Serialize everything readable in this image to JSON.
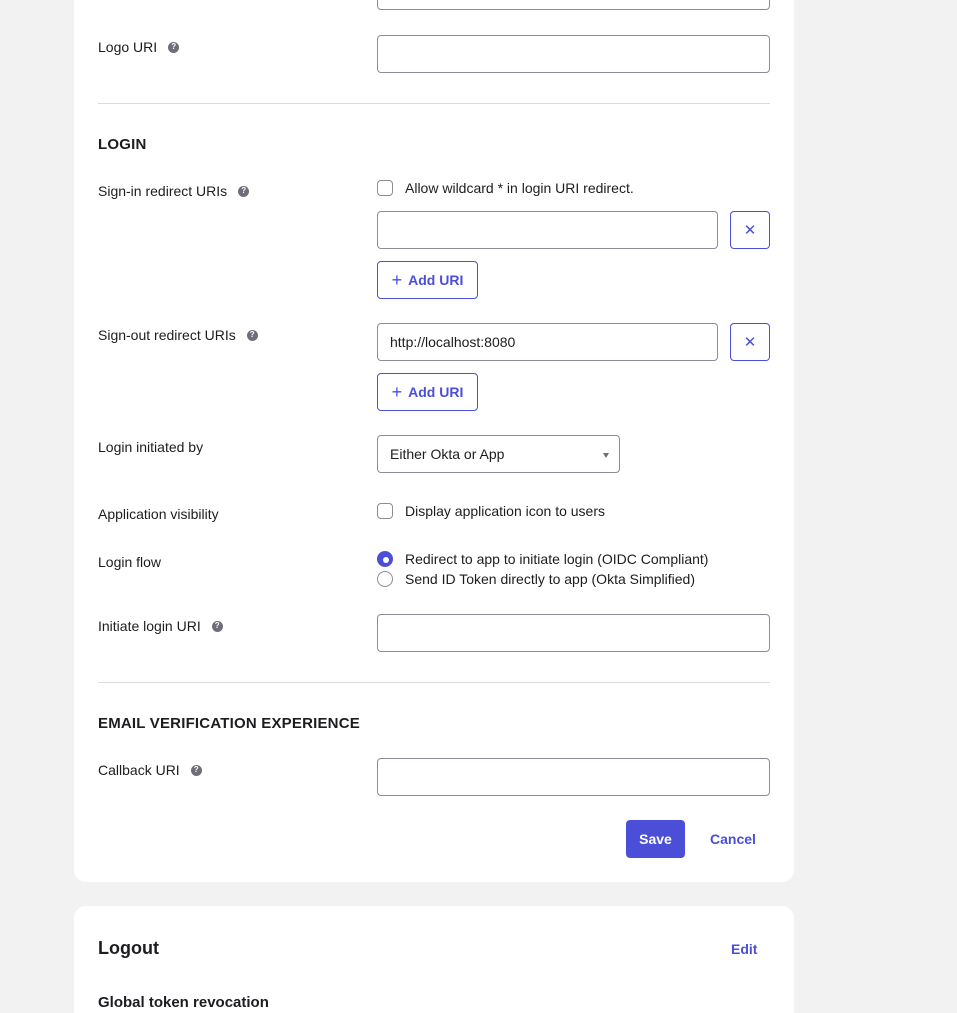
{
  "general": {
    "logo_uri_label": "Logo URI",
    "logo_uri_value": ""
  },
  "login": {
    "section_title": "LOGIN",
    "signin": {
      "label": "Sign-in redirect URIs",
      "wildcard_label": "Allow wildcard * in login URI redirect.",
      "uri_value": "",
      "add_label": "Add URI"
    },
    "signout": {
      "label": "Sign-out redirect URIs",
      "uri_value": "http://localhost:8080",
      "add_label": "Add URI"
    },
    "initiated_by": {
      "label": "Login initiated by",
      "selected": "Either Okta or App"
    },
    "visibility": {
      "label": "Application visibility",
      "option": "Display application icon to users"
    },
    "flow": {
      "label": "Login flow",
      "option_redirect": "Redirect to app to initiate login (OIDC Compliant)",
      "option_send": "Send ID Token directly to app (Okta Simplified)"
    },
    "initiate_uri": {
      "label": "Initiate login URI",
      "value": ""
    }
  },
  "email": {
    "section_title": "EMAIL VERIFICATION EXPERIENCE",
    "callback_label": "Callback URI",
    "callback_value": ""
  },
  "actions": {
    "save": "Save",
    "cancel": "Cancel"
  },
  "logout": {
    "title": "Logout",
    "edit": "Edit",
    "global_revocation": "Global token revocation"
  },
  "colors": {
    "accent": "#4b4fd8",
    "background": "#f2f2f2",
    "card": "#ffffff",
    "border": "#8c8c96"
  }
}
